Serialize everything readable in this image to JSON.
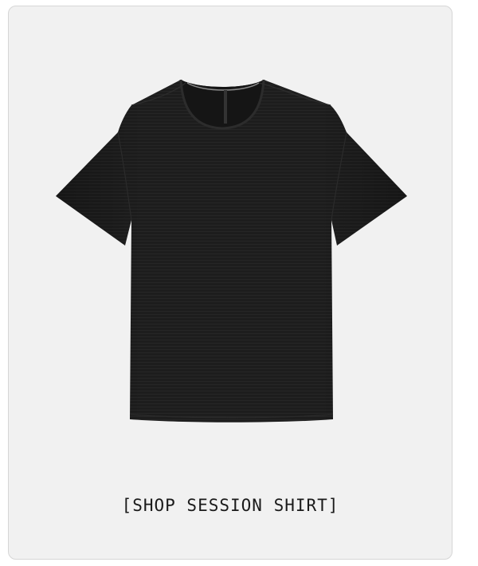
{
  "card": {
    "cta_label": "[SHOP SESSION SHIRT]"
  },
  "product": {
    "image_subject": "black-tshirt",
    "color": "#1c1c1c",
    "background": "#f1f1f1"
  }
}
